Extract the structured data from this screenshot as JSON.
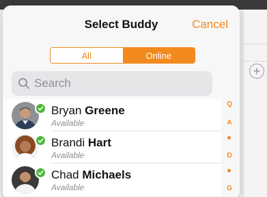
{
  "header": {
    "title": "Select Buddy",
    "cancel_label": "Cancel"
  },
  "filter": {
    "options": [
      "All",
      "Online"
    ],
    "selected": "Online"
  },
  "search": {
    "placeholder": "Search"
  },
  "buddies": [
    {
      "first_name": "Bryan",
      "last_name": "Greene",
      "status": "Available",
      "presence": "online"
    },
    {
      "first_name": "Brandi",
      "last_name": "Hart",
      "status": "Available",
      "presence": "online"
    },
    {
      "first_name": "Chad",
      "last_name": "Michaels",
      "status": "Available",
      "presence": "online"
    }
  ],
  "section_index": [
    "Q",
    "A",
    "•",
    "D",
    "•",
    "G"
  ],
  "colors": {
    "accent": "#f28a1e",
    "presence_online": "#4cb63c"
  },
  "icons": {
    "search": "magnifier",
    "add": "plus-circle",
    "presence": "check"
  }
}
